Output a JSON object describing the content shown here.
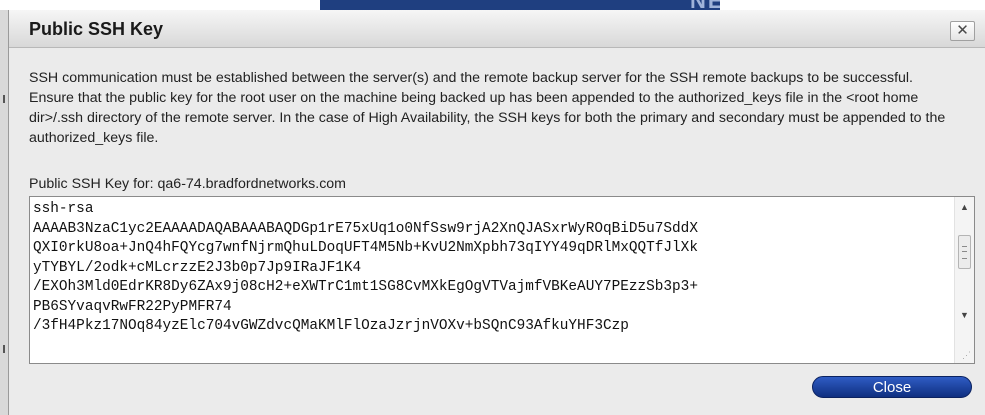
{
  "background": {
    "app_title": "NETWORK CENTRY"
  },
  "dialog": {
    "title": "Public SSH Key",
    "close_glyph": "✕",
    "description": "SSH communication must be established between the server(s) and the remote backup server for the SSH remote backups to be successful. Ensure that the public key for the root user on the machine being backed up has been appended to the authorized_keys file in the <root home dir>/.ssh directory of the remote server. In the case of High Availability, the SSH keys for both the primary and secondary must be appended to the authorized_keys file.",
    "key_label": "Public SSH Key for: qa6-74.bradfordnetworks.com",
    "key_lines": [
      "ssh-rsa",
      "AAAAB3NzaC1yc2EAAAADAQABAAABAQDGp1rE75xUq1o0NfSsw9rjA2XnQJASxrWyROqBiD5u7SddX",
      "QXI0rkU8oa+JnQ4hFQYcg7wnfNjrmQhuLDoqUFT4M5Nb+KvU2NmXpbh73qIYY49qDRlMxQQTfJlXk",
      "yTYBYL/2odk+cMLcrzzE2J3b0p7Jp9IRaJF1K4",
      "/EXOh3Mld0EdrKR8Dy6ZAx9j08cH2+eXWTrC1mt1SG8CvMXkEgOgVTVajmfVBKeAUY7PEzzSb3p3+",
      "PB6SYvaqvRwFR22PyPMFR74",
      "/3fH4Pkz17NOq84yzElc704vGWZdvcQMaKMlFlOzaJzrjnVOXv+bSQnC93AfkuYHF3Czp"
    ],
    "close_button_label": "Close"
  },
  "icons": {
    "scroll_up": "▲",
    "scroll_down": "▼",
    "resize_grip": "⋰"
  }
}
